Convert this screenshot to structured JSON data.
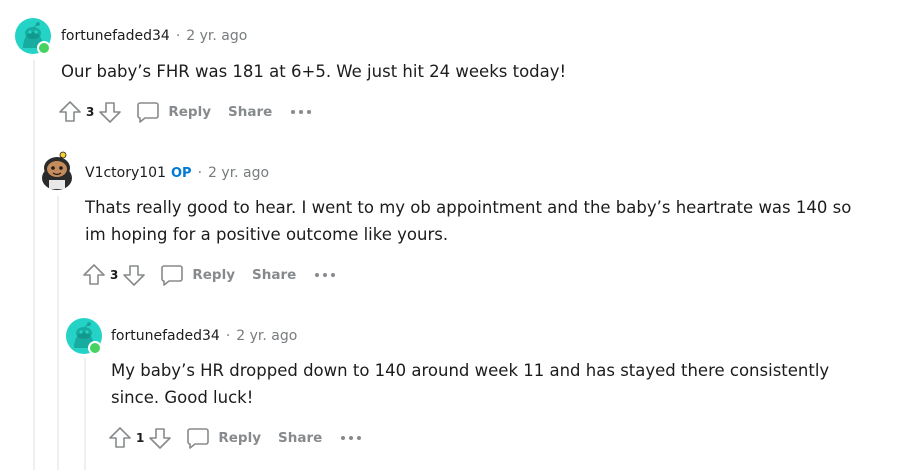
{
  "comments": [
    {
      "author": "fortunefaded34",
      "op": "",
      "time": "2 yr. ago",
      "body": "Our baby’s FHR was 181 at 6+5. We just hit 24 weeks today!",
      "votes": "3",
      "reply_label": "Reply",
      "share_label": "Share",
      "avatar": "snoo-avatar-teal"
    },
    {
      "author": "V1ctory101",
      "op": "OP",
      "time": "2 yr. ago",
      "body": "Thats really good to hear. I went to my ob appointment and the baby’s heartrate was 140 so im hoping for a positive outcome like yours.",
      "votes": "3",
      "reply_label": "Reply",
      "share_label": "Share",
      "avatar": "snoo-avatar-custom"
    },
    {
      "author": "fortunefaded34",
      "op": "",
      "time": "2 yr. ago",
      "body": "My baby’s HR dropped down to 140 around week 11 and has stayed there consistently since. Good luck!",
      "votes": "1",
      "reply_label": "Reply",
      "share_label": "Share",
      "avatar": "snoo-avatar-teal"
    }
  ],
  "colors": {
    "op": "#0079d3",
    "meta": "#787c7e",
    "action": "#878a8c",
    "online": "#46d160",
    "avatar_teal": "#24d3c6"
  }
}
